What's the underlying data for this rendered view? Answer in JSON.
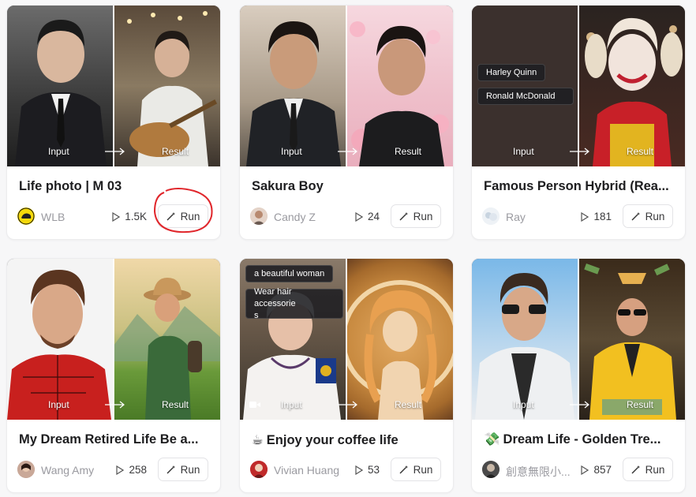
{
  "labels": {
    "input": "Input",
    "result": "Result",
    "run": "Run"
  },
  "cards": [
    {
      "title": "Life photo | M 03",
      "author": "WLB",
      "runs": "1.5K"
    },
    {
      "title": "Sakura Boy",
      "author": "Candy Z",
      "runs": "24"
    },
    {
      "title": "Famous Person Hybrid (Rea...",
      "author": "Ray",
      "runs": "181",
      "chips": [
        "Harley Quinn",
        "Ronald McDonald"
      ]
    },
    {
      "title": "My Dream Retired Life Be a...",
      "author": "Wang Amy",
      "runs": "258"
    },
    {
      "title_emoji": "☕",
      "title": "Enjoy your coffee life",
      "author": "Vivian Huang",
      "runs": "53",
      "chips": [
        "a beautiful woman",
        "Wear hair accessorie\ns"
      ]
    },
    {
      "title_emoji": "💸",
      "title": "Dream Life - Golden Tre...",
      "author": "創意無限小...",
      "runs": "857"
    }
  ],
  "colors": {
    "annotation": "#e0262b",
    "accent_border": "#e3e3e6"
  }
}
